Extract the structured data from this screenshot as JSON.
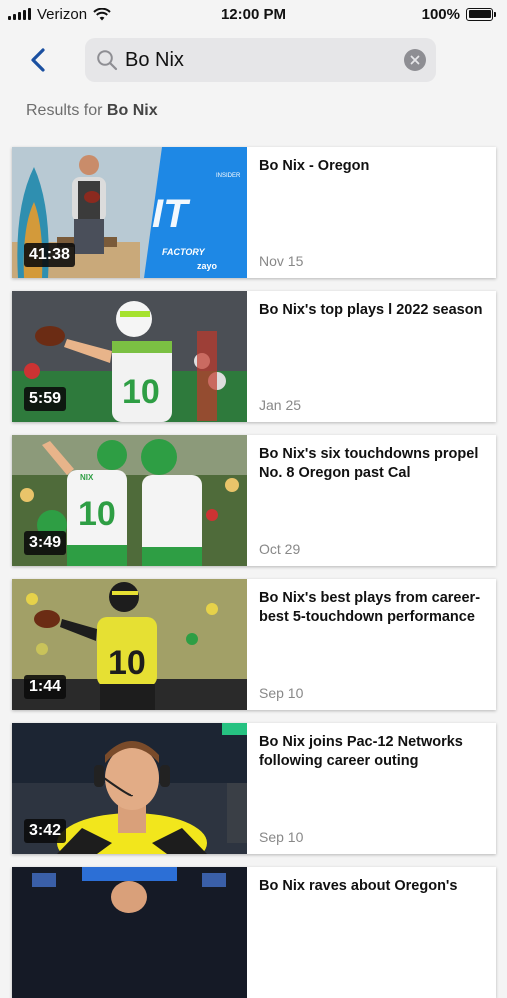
{
  "status_bar": {
    "carrier": "Verizon",
    "time": "12:00 PM",
    "battery": "100%",
    "battery_level": 1.0
  },
  "search": {
    "query": "Bo Nix",
    "back_icon": "chevron-left-icon",
    "search_icon": "magnifier-icon",
    "clear_icon": "clear-x-icon"
  },
  "results": {
    "prefix": "Results for ",
    "query": "Bo Nix"
  },
  "videos": [
    {
      "title": "Bo Nix - Oregon",
      "date": "Nov 15",
      "duration": "41:38"
    },
    {
      "title": "Bo Nix's top plays l 2022 season",
      "date": "Jan 25",
      "duration": "5:59"
    },
    {
      "title": "Bo Nix's six touchdowns propel No. 8 Oregon past Cal",
      "date": "Oct 29",
      "duration": "3:49"
    },
    {
      "title": "Bo Nix's best plays from career-best 5-touchdown performance",
      "date": "Sep 10",
      "duration": "1:44"
    },
    {
      "title": "Bo Nix joins Pac-12 Networks following career outing",
      "date": "Sep 10",
      "duration": "3:42"
    },
    {
      "title": "Bo Nix raves about Oregon's",
      "date": "",
      "duration": ""
    }
  ],
  "thumb_art": {
    "t1_brand": "THE IT FACTORY",
    "t1_sub": "zayo",
    "t1_tag": "INSIDER",
    "jersey_a": "10",
    "jersey_b": "10",
    "jersey_c": "10",
    "jersey_name": "NIX"
  }
}
